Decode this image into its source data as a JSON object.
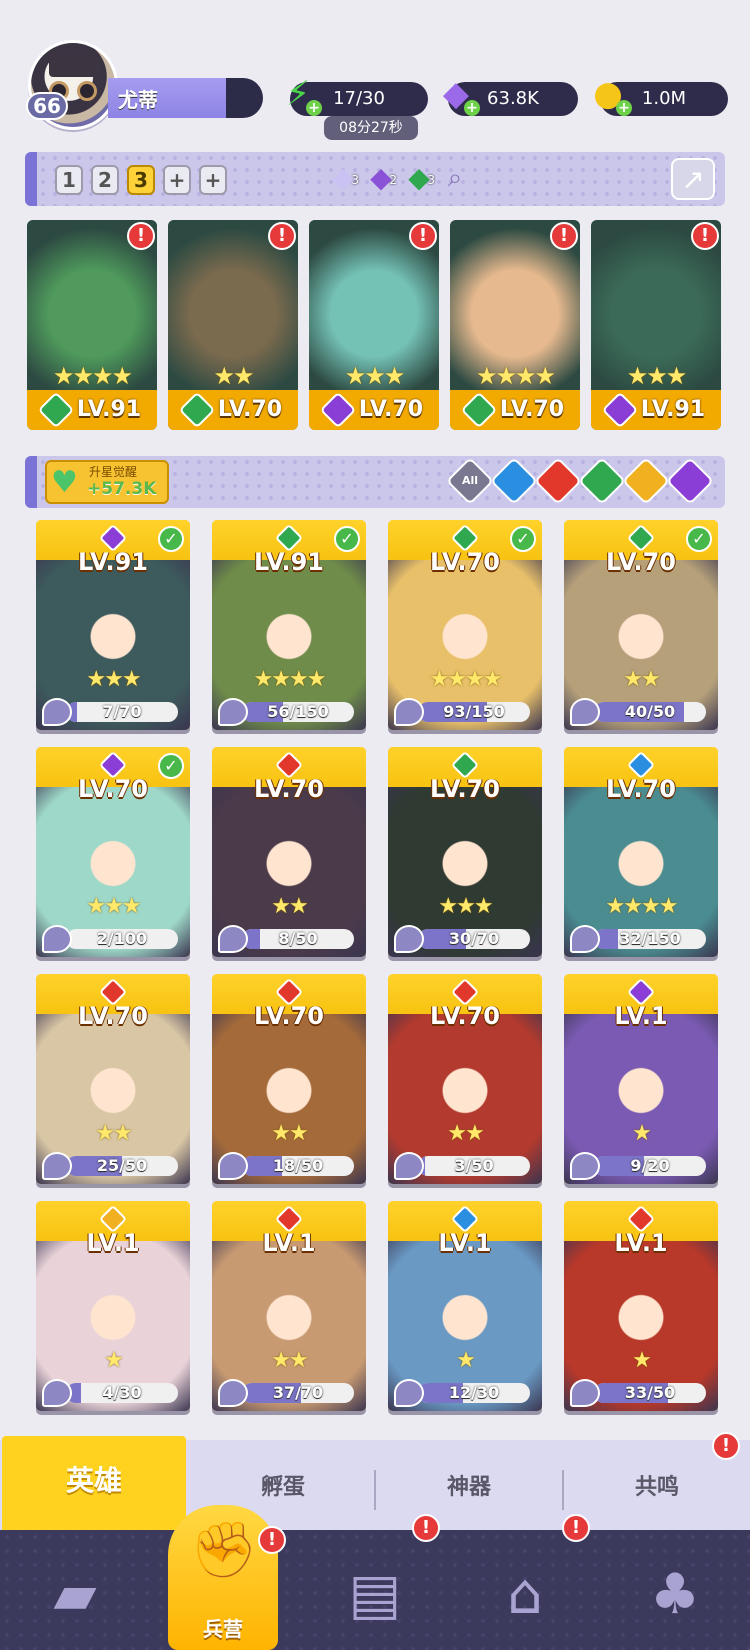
{
  "player": {
    "name": "尤蒂",
    "level": "66"
  },
  "resources": {
    "energy": {
      "icon": "lightning-icon",
      "value": "17/30",
      "timer": "08分27秒"
    },
    "gems": {
      "icon": "diamond-icon",
      "value": "63.8K"
    },
    "gold": {
      "icon": "coin-icon",
      "value": "1.0M"
    }
  },
  "team_slots": [
    "1",
    "2",
    "3",
    "+",
    "+"
  ],
  "active_team_slot": "3",
  "element_counts": [
    {
      "icon": "light-element-icon",
      "count": "3",
      "color": "#c9c2f2"
    },
    {
      "icon": "dark-element-icon",
      "count": "2",
      "color": "#8a52d6"
    },
    {
      "icon": "nature-element-icon",
      "count": "3",
      "color": "#2fa850"
    }
  ],
  "team": [
    {
      "level": "LV.91",
      "element": "nature",
      "stars": 4,
      "color": "#4f9a5c"
    },
    {
      "level": "LV.70",
      "element": "nature",
      "stars": 2,
      "color": "#7a6a4e"
    },
    {
      "level": "LV.70",
      "element": "dark",
      "stars": 3,
      "color": "#74c1b5"
    },
    {
      "level": "LV.70",
      "element": "nature",
      "stars": 4,
      "color": "#e6b98e"
    },
    {
      "level": "LV.91",
      "element": "dark",
      "stars": 3,
      "color": "#3b6b58"
    }
  ],
  "awaken": {
    "title": "升星觉醒",
    "value": "+57.3K"
  },
  "filters": [
    {
      "icon": "all-filter-icon",
      "label": "All",
      "color": "#7a7890"
    },
    {
      "icon": "water-filter-icon",
      "label": "",
      "color": "#2a8fe0"
    },
    {
      "icon": "fire-filter-icon",
      "label": "",
      "color": "#e2382c"
    },
    {
      "icon": "nature-filter-icon",
      "label": "",
      "color": "#2fa84f"
    },
    {
      "icon": "light-filter-icon",
      "label": "",
      "color": "#f0b020"
    },
    {
      "icon": "dark-filter-icon",
      "label": "",
      "color": "#8a3ed6"
    }
  ],
  "heroes": [
    {
      "level": "LV.91",
      "element": "dark",
      "stars": 3,
      "progress": "7/70",
      "ratio": 0.1,
      "selected": true,
      "art": "#3d5a5c"
    },
    {
      "level": "LV.91",
      "element": "nature",
      "stars": 4,
      "progress": "56/150",
      "ratio": 0.37,
      "selected": true,
      "art": "#6f8c4a"
    },
    {
      "level": "LV.70",
      "element": "nature",
      "stars": 4,
      "progress": "93/150",
      "ratio": 0.62,
      "selected": true,
      "art": "#e8c06a"
    },
    {
      "level": "LV.70",
      "element": "nature",
      "stars": 2,
      "progress": "40/50",
      "ratio": 0.8,
      "selected": true,
      "art": "#b5a07a"
    },
    {
      "level": "LV.70",
      "element": "dark",
      "stars": 3,
      "progress": "2/100",
      "ratio": 0.02,
      "selected": true,
      "art": "#9ed8c8"
    },
    {
      "level": "LV.70",
      "element": "fire",
      "stars": 2,
      "progress": "8/50",
      "ratio": 0.16,
      "selected": false,
      "art": "#4a3a4a"
    },
    {
      "level": "LV.70",
      "element": "nature",
      "stars": 3,
      "progress": "30/70",
      "ratio": 0.43,
      "selected": false,
      "art": "#2f3a32"
    },
    {
      "level": "LV.70",
      "element": "water",
      "stars": 4,
      "progress": "32/150",
      "ratio": 0.21,
      "selected": false,
      "art": "#4a8c90"
    },
    {
      "level": "LV.70",
      "element": "fire",
      "stars": 2,
      "progress": "25/50",
      "ratio": 0.5,
      "selected": false,
      "art": "#d9c6a4"
    },
    {
      "level": "LV.70",
      "element": "fire",
      "stars": 2,
      "progress": "18/50",
      "ratio": 0.36,
      "selected": false,
      "art": "#a46a3a"
    },
    {
      "level": "LV.70",
      "element": "fire",
      "stars": 2,
      "progress": "3/50",
      "ratio": 0.06,
      "selected": false,
      "art": "#b23a2e"
    },
    {
      "level": "LV.1",
      "element": "dark",
      "stars": 1,
      "progress": "9/20",
      "ratio": 0.45,
      "selected": false,
      "art": "#7a5ab2"
    },
    {
      "level": "LV.1",
      "element": "light",
      "stars": 1,
      "progress": "4/30",
      "ratio": 0.13,
      "selected": false,
      "art": "#e9d2d8"
    },
    {
      "level": "LV.1",
      "element": "fire",
      "stars": 2,
      "progress": "37/70",
      "ratio": 0.53,
      "selected": false,
      "art": "#c89a72"
    },
    {
      "level": "LV.1",
      "element": "water",
      "stars": 1,
      "progress": "12/30",
      "ratio": 0.4,
      "selected": false,
      "art": "#6a9ac4"
    },
    {
      "level": "LV.1",
      "element": "fire",
      "stars": 1,
      "progress": "33/50",
      "ratio": 0.66,
      "selected": false,
      "art": "#b8382a"
    }
  ],
  "element_colors": {
    "nature": "#2fa84f",
    "dark": "#8a3ed6",
    "fire": "#e2382c",
    "water": "#2a8fe0",
    "light": "#f0b020"
  },
  "subtabs": [
    "英雄",
    "孵蛋",
    "神器",
    "共鸣"
  ],
  "nav": {
    "active_label": "兵营",
    "items": [
      {
        "icon": "cards-icon"
      },
      {
        "icon": "barracks-icon"
      },
      {
        "icon": "map-book-icon"
      },
      {
        "icon": "shrine-icon"
      },
      {
        "icon": "mushroom-icon"
      }
    ]
  },
  "alert_mark": "!",
  "check_mark": "✓"
}
